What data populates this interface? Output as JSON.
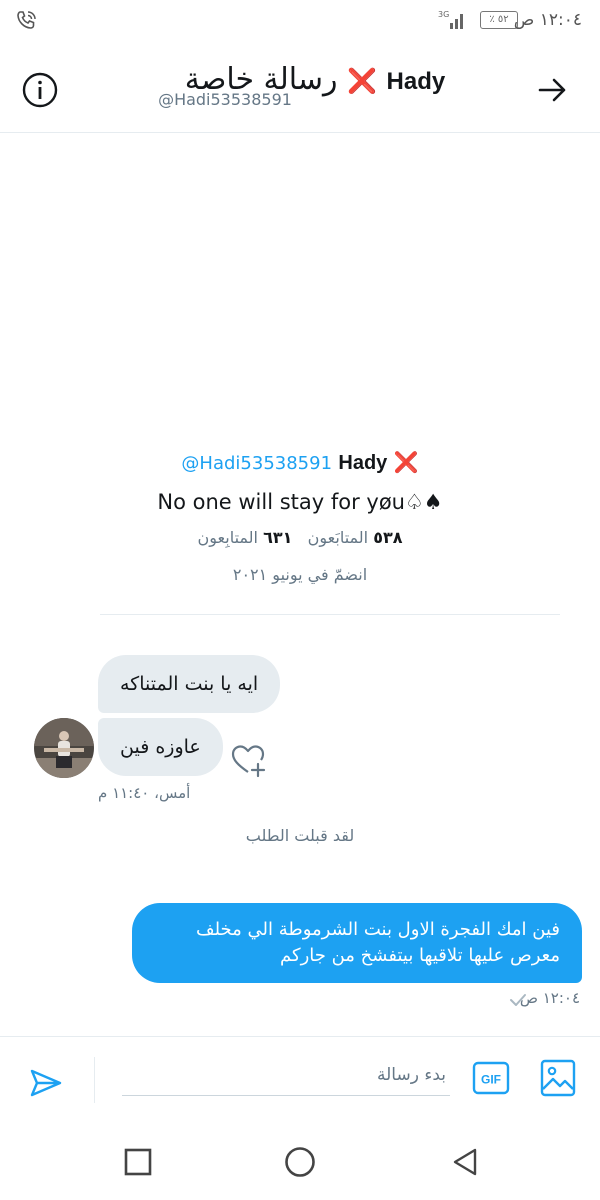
{
  "status_bar": {
    "time": "١٢:٠٤ ص",
    "battery": "٥٢ ٪",
    "network": "3G"
  },
  "header": {
    "title": "رسالة خاصة",
    "name": "Hady",
    "name_emoji": "❌",
    "handle": "@Hadi53538591"
  },
  "profile": {
    "name": "Hady",
    "name_emoji": "❌",
    "handle": "@Hadi53538591",
    "bio": "No one will stay for yøu♤♠",
    "following_count": "٥٣٨",
    "following_label": "المتابَعون",
    "followers_count": "٦٣١",
    "followers_label": "المتابِعون",
    "joined": "انضمّ في يونيو ٢٠٢١"
  },
  "conversation": {
    "incoming": [
      {
        "text": "ايه يا بنت المتناكه"
      },
      {
        "text": "عاوزه فين"
      }
    ],
    "incoming_timestamp": "أمس، ١١:٤٠ م",
    "accepted_notice": "لقد قبلت الطلب",
    "outgoing": [
      {
        "text": "فين امك الفجرة الاول بنت الشرموطة الي مخلف معرص عليها تلاقيها بيتفشخ من جاركم"
      }
    ],
    "outgoing_timestamp": "١٢:٠٤ ص"
  },
  "composer": {
    "placeholder": "بدء رسالة",
    "gif_label": "GIF"
  },
  "colors": {
    "accent": "#1da1f2",
    "incoming_bubble": "#e6ecf0",
    "muted_text": "#657786",
    "emoji_red": "#e0245e"
  }
}
